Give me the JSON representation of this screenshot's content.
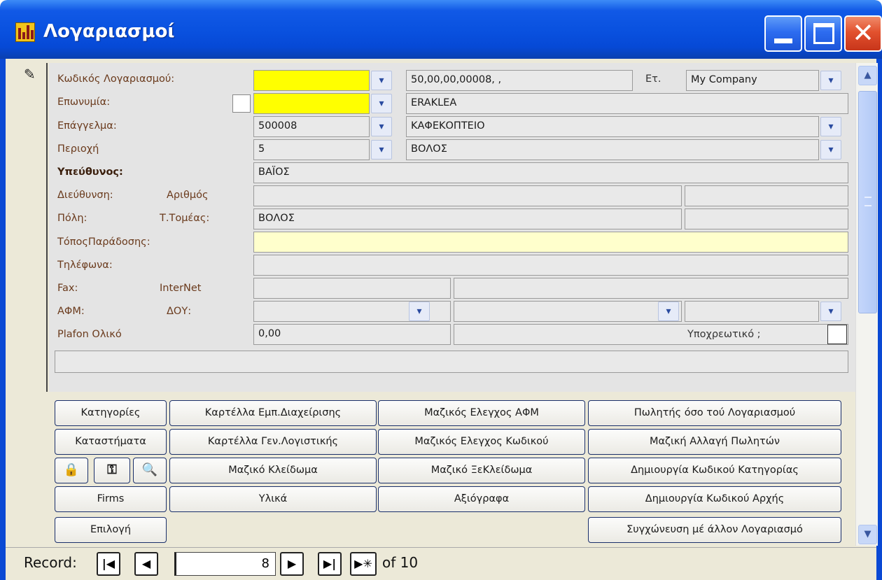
{
  "window": {
    "title": "Λογαριασμοί"
  },
  "fields": {
    "account_code": {
      "label": "Κωδικός Λογαριασμού:",
      "value": "",
      "display": "50,00,00,00008,  ,"
    },
    "company": {
      "label": "Ετ.",
      "value": "My Company"
    },
    "name": {
      "label": "Επωνυμία:",
      "value": "",
      "display": "ERAKLEA"
    },
    "profession": {
      "label": "Επάγγελμα:",
      "code": "500008",
      "value": "ΚΑΦΕΚΟΠΤΕΙΟ"
    },
    "area": {
      "label": "Περιοχή",
      "code": "5",
      "value": "ΒΟΛΟΣ"
    },
    "responsible": {
      "label": "Υπεύθυνος:",
      "value": "ΒΑΪΟΣ"
    },
    "address": {
      "label": "Διεύθυνση:",
      "number_label": "Αριθμός",
      "value": "",
      "number": "",
      "extra": ""
    },
    "city": {
      "label": "Πόλη:",
      "postcode_label": "Τ.Τομέας:",
      "value": "ΒΟΛΟΣ",
      "postcode": ""
    },
    "delivery_place": {
      "label": "ΤόποςΠαράδοσης:",
      "value": ""
    },
    "phones": {
      "label": "Τηλέφωνα:",
      "value": ""
    },
    "fax": {
      "label": "Fax:",
      "internet_label": "InterNet",
      "value": "",
      "internet": ""
    },
    "vat": {
      "label": "ΑΦΜ:",
      "tax_office_label": "ΔΟΥ:",
      "value": "",
      "tax_office": "",
      "extra": ""
    },
    "plafond": {
      "label": "Plafon Ολικό",
      "value": "0,00",
      "mandatory_label": "Υποχρεωτικό ;"
    }
  },
  "buttons": {
    "categories": "Κατηγορίες",
    "stores": "Καταστήματα",
    "firms": "Firms",
    "select": "Επιλογή",
    "commercial_card": "Καρτέλλα Εμπ.Διαχείρισης",
    "general_card": "Καρτέλλα Γεν.Λογιστικής",
    "mass_lock": "Μαζικό Κλείδωμα",
    "materials": "Υλικά",
    "mass_vat_check": "Μαζικός Ελεγχος ΑΦΜ",
    "mass_code_check": "Μαζικός Ελεγχος Κωδικού",
    "mass_unlock": "Μαζικό ΞεΚλείδωμα",
    "securities": "Αξιόγραφα",
    "seller_as_account": "Πωλητής όσο τού Λογαριασμού",
    "mass_seller_change": "Μαζική Αλλαγή Πωλητών",
    "create_category_code": "Δημιουργία Κωδικού Κατηγορίας",
    "create_start_code": "Δημιουργία Κωδικού Αρχής",
    "merge_account": "Συγχώνευση μέ άλλον Λογαριασμό"
  },
  "icons": {
    "lock": "🔒",
    "key": "⚿",
    "search_doc": "🔍"
  },
  "navigator": {
    "label": "Record:",
    "current": "8",
    "of_text": "of  10"
  }
}
